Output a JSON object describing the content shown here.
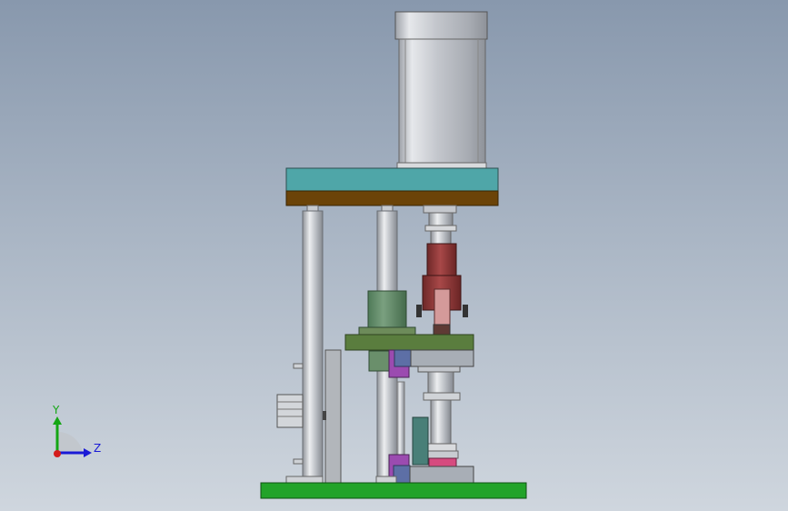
{
  "viewport": {
    "background_top": "#8898ad",
    "background_bottom": "#cfd6de"
  },
  "triad": {
    "y_label": "Y",
    "z_label": "Z",
    "y_color": "#14a614",
    "z_color": "#1a1ad6",
    "x_color": "#d41c1c"
  },
  "parts": {
    "cylinder_color": "#c9ccd2",
    "top_plate_color": "#4fa6a8",
    "mid_plate_brown": "#6b4308",
    "base_color": "#22a329",
    "green_plate_color": "#5a7d3e",
    "red_block_color": "#8b3434",
    "purple_color": "#9b4bb0"
  }
}
